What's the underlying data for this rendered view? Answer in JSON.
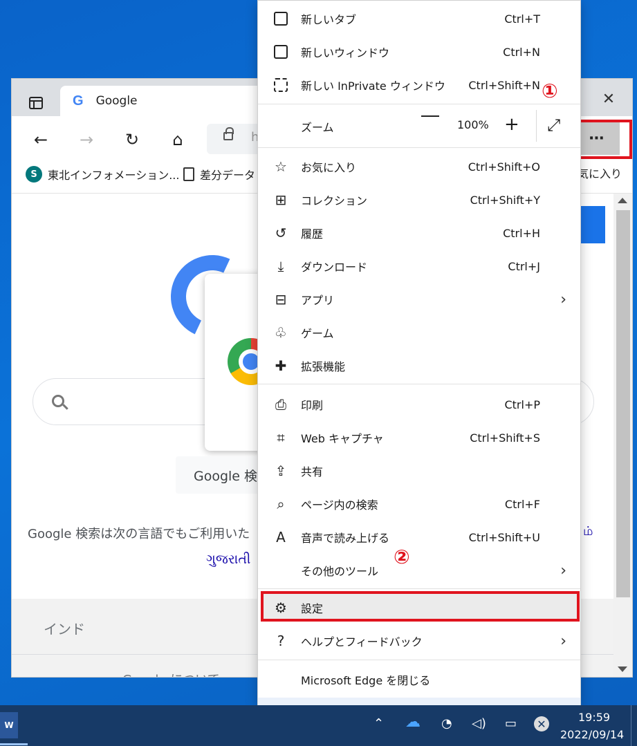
{
  "browser": {
    "tab_title": "Google",
    "address_partial": "h",
    "more_button": "⋯",
    "favorites": [
      {
        "label": "東北インフォメーション..."
      },
      {
        "label": "差分データ"
      }
    ],
    "favorites_right": "気に入り",
    "page": {
      "search_button": "Google 検",
      "language_line": "Google 検索は次の言語でもご利用いた",
      "language_right": "ம்",
      "language_link": "ગુજરાતી",
      "footer_country": "インド",
      "footer_about": "Google について"
    }
  },
  "menu": {
    "items": [
      {
        "label": "新しいタブ",
        "shortcut": "Ctrl+T",
        "icon": "new-tab-icon"
      },
      {
        "label": "新しいウィンドウ",
        "shortcut": "Ctrl+N",
        "icon": "new-window-icon"
      },
      {
        "label": "新しい InPrivate ウィンドウ",
        "shortcut": "Ctrl+Shift+N",
        "icon": "inprivate-icon"
      },
      {
        "label": "お気に入り",
        "shortcut": "Ctrl+Shift+O",
        "icon": "favorites-icon"
      },
      {
        "label": "コレクション",
        "shortcut": "Ctrl+Shift+Y",
        "icon": "collections-icon"
      },
      {
        "label": "履歴",
        "shortcut": "Ctrl+H",
        "icon": "history-icon"
      },
      {
        "label": "ダウンロード",
        "shortcut": "Ctrl+J",
        "icon": "download-icon"
      },
      {
        "label": "アプリ",
        "shortcut": "",
        "icon": "apps-icon"
      },
      {
        "label": "ゲーム",
        "shortcut": "",
        "icon": "games-icon"
      },
      {
        "label": "拡張機能",
        "shortcut": "",
        "icon": "extensions-icon"
      },
      {
        "label": "印刷",
        "shortcut": "Ctrl+P",
        "icon": "print-icon"
      },
      {
        "label": "Web キャプチャ",
        "shortcut": "Ctrl+Shift+S",
        "icon": "web-capture-icon"
      },
      {
        "label": "共有",
        "shortcut": "",
        "icon": "share-icon"
      },
      {
        "label": "ページ内の検索",
        "shortcut": "Ctrl+F",
        "icon": "find-icon"
      },
      {
        "label": "音声で読み上げる",
        "shortcut": "Ctrl+Shift+U",
        "icon": "read-aloud-icon"
      },
      {
        "label": "その他のツール",
        "shortcut": "",
        "icon": ""
      },
      {
        "label": "設定",
        "shortcut": "",
        "icon": "settings-icon"
      },
      {
        "label": "ヘルプとフィードバック",
        "shortcut": "",
        "icon": "help-icon"
      },
      {
        "label": "Microsoft Edge を閉じる",
        "shortcut": "",
        "icon": ""
      }
    ],
    "zoom": {
      "label": "ズーム",
      "value": "100%"
    }
  },
  "annotations": {
    "step1": "①",
    "step2": "②",
    "highlight_color": "#e0141e"
  },
  "taskbar": {
    "time": "19:59",
    "date": "2022/09/14"
  }
}
